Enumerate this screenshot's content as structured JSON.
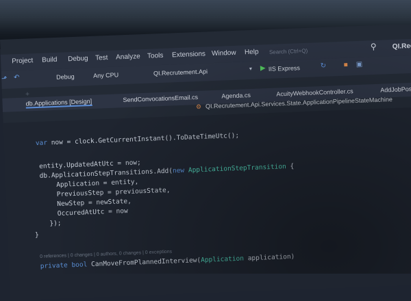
{
  "window": {
    "title": "QI.Recr"
  },
  "menu": [
    "Project",
    "Build",
    "Debug",
    "Test",
    "Analyze",
    "Tools",
    "Extensions",
    "Window",
    "Help"
  ],
  "search": {
    "placeholder": "Search (Ctrl+Q)"
  },
  "toolbar": {
    "config": "Debug",
    "platform": "Any CPU",
    "project": "QI.Recrutement.Api",
    "run": "IIS Express"
  },
  "tabs": [
    "db.Applications [Design]",
    "SendConvocationsEmail.cs",
    "Agenda.cs",
    "AcuityWebhookController.cs",
    "AddJobPositi"
  ],
  "breadcrumb": "QI.Recrutement.Api.Services.State.ApplicationPipelineStateMachine",
  "code": {
    "line1": {
      "kw": "var",
      "rest": " now = clock.GetCurrentInstant().ToDateTimeUtc();"
    },
    "line2": "entity.UpdatedAtUtc = now;",
    "line3": {
      "pre": "db.ApplicationStepTransitions.Add(",
      "kw": "new",
      "type": " ApplicationStepTransition",
      "post": " {"
    },
    "line4": "Application = entity,",
    "line5": "PreviousStep = previousState,",
    "line6": "NewStep = newState,",
    "line7": "OccuredAtUtc = now",
    "line8": "});",
    "line9": "}",
    "codelens": "0 references | 0 changes | 0 authors, 0 changes | 0 exceptions",
    "line10": {
      "kw1": "private",
      "kw2": " bool",
      "name": " CanMoveFromPlannedInterview(",
      "type": "Application",
      "post": " application)"
    }
  }
}
